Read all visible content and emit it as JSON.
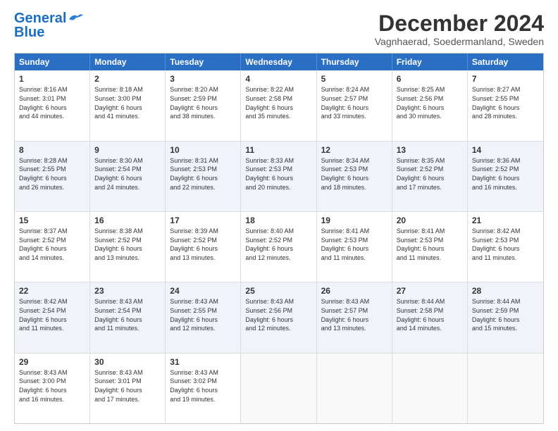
{
  "header": {
    "logo_line1": "General",
    "logo_line2": "Blue",
    "month_title": "December 2024",
    "subtitle": "Vagnhaerad, Soedermanland, Sweden"
  },
  "weekdays": [
    "Sunday",
    "Monday",
    "Tuesday",
    "Wednesday",
    "Thursday",
    "Friday",
    "Saturday"
  ],
  "rows": [
    [
      {
        "day": "1",
        "lines": [
          "Sunrise: 8:16 AM",
          "Sunset: 3:01 PM",
          "Daylight: 6 hours",
          "and 44 minutes."
        ]
      },
      {
        "day": "2",
        "lines": [
          "Sunrise: 8:18 AM",
          "Sunset: 3:00 PM",
          "Daylight: 6 hours",
          "and 41 minutes."
        ]
      },
      {
        "day": "3",
        "lines": [
          "Sunrise: 8:20 AM",
          "Sunset: 2:59 PM",
          "Daylight: 6 hours",
          "and 38 minutes."
        ]
      },
      {
        "day": "4",
        "lines": [
          "Sunrise: 8:22 AM",
          "Sunset: 2:58 PM",
          "Daylight: 6 hours",
          "and 35 minutes."
        ]
      },
      {
        "day": "5",
        "lines": [
          "Sunrise: 8:24 AM",
          "Sunset: 2:57 PM",
          "Daylight: 6 hours",
          "and 33 minutes."
        ]
      },
      {
        "day": "6",
        "lines": [
          "Sunrise: 8:25 AM",
          "Sunset: 2:56 PM",
          "Daylight: 6 hours",
          "and 30 minutes."
        ]
      },
      {
        "day": "7",
        "lines": [
          "Sunrise: 8:27 AM",
          "Sunset: 2:55 PM",
          "Daylight: 6 hours",
          "and 28 minutes."
        ]
      }
    ],
    [
      {
        "day": "8",
        "lines": [
          "Sunrise: 8:28 AM",
          "Sunset: 2:55 PM",
          "Daylight: 6 hours",
          "and 26 minutes."
        ]
      },
      {
        "day": "9",
        "lines": [
          "Sunrise: 8:30 AM",
          "Sunset: 2:54 PM",
          "Daylight: 6 hours",
          "and 24 minutes."
        ]
      },
      {
        "day": "10",
        "lines": [
          "Sunrise: 8:31 AM",
          "Sunset: 2:53 PM",
          "Daylight: 6 hours",
          "and 22 minutes."
        ]
      },
      {
        "day": "11",
        "lines": [
          "Sunrise: 8:33 AM",
          "Sunset: 2:53 PM",
          "Daylight: 6 hours",
          "and 20 minutes."
        ]
      },
      {
        "day": "12",
        "lines": [
          "Sunrise: 8:34 AM",
          "Sunset: 2:53 PM",
          "Daylight: 6 hours",
          "and 18 minutes."
        ]
      },
      {
        "day": "13",
        "lines": [
          "Sunrise: 8:35 AM",
          "Sunset: 2:52 PM",
          "Daylight: 6 hours",
          "and 17 minutes."
        ]
      },
      {
        "day": "14",
        "lines": [
          "Sunrise: 8:36 AM",
          "Sunset: 2:52 PM",
          "Daylight: 6 hours",
          "and 16 minutes."
        ]
      }
    ],
    [
      {
        "day": "15",
        "lines": [
          "Sunrise: 8:37 AM",
          "Sunset: 2:52 PM",
          "Daylight: 6 hours",
          "and 14 minutes."
        ]
      },
      {
        "day": "16",
        "lines": [
          "Sunrise: 8:38 AM",
          "Sunset: 2:52 PM",
          "Daylight: 6 hours",
          "and 13 minutes."
        ]
      },
      {
        "day": "17",
        "lines": [
          "Sunrise: 8:39 AM",
          "Sunset: 2:52 PM",
          "Daylight: 6 hours",
          "and 13 minutes."
        ]
      },
      {
        "day": "18",
        "lines": [
          "Sunrise: 8:40 AM",
          "Sunset: 2:52 PM",
          "Daylight: 6 hours",
          "and 12 minutes."
        ]
      },
      {
        "day": "19",
        "lines": [
          "Sunrise: 8:41 AM",
          "Sunset: 2:53 PM",
          "Daylight: 6 hours",
          "and 11 minutes."
        ]
      },
      {
        "day": "20",
        "lines": [
          "Sunrise: 8:41 AM",
          "Sunset: 2:53 PM",
          "Daylight: 6 hours",
          "and 11 minutes."
        ]
      },
      {
        "day": "21",
        "lines": [
          "Sunrise: 8:42 AM",
          "Sunset: 2:53 PM",
          "Daylight: 6 hours",
          "and 11 minutes."
        ]
      }
    ],
    [
      {
        "day": "22",
        "lines": [
          "Sunrise: 8:42 AM",
          "Sunset: 2:54 PM",
          "Daylight: 6 hours",
          "and 11 minutes."
        ]
      },
      {
        "day": "23",
        "lines": [
          "Sunrise: 8:43 AM",
          "Sunset: 2:54 PM",
          "Daylight: 6 hours",
          "and 11 minutes."
        ]
      },
      {
        "day": "24",
        "lines": [
          "Sunrise: 8:43 AM",
          "Sunset: 2:55 PM",
          "Daylight: 6 hours",
          "and 12 minutes."
        ]
      },
      {
        "day": "25",
        "lines": [
          "Sunrise: 8:43 AM",
          "Sunset: 2:56 PM",
          "Daylight: 6 hours",
          "and 12 minutes."
        ]
      },
      {
        "day": "26",
        "lines": [
          "Sunrise: 8:43 AM",
          "Sunset: 2:57 PM",
          "Daylight: 6 hours",
          "and 13 minutes."
        ]
      },
      {
        "day": "27",
        "lines": [
          "Sunrise: 8:44 AM",
          "Sunset: 2:58 PM",
          "Daylight: 6 hours",
          "and 14 minutes."
        ]
      },
      {
        "day": "28",
        "lines": [
          "Sunrise: 8:44 AM",
          "Sunset: 2:59 PM",
          "Daylight: 6 hours",
          "and 15 minutes."
        ]
      }
    ],
    [
      {
        "day": "29",
        "lines": [
          "Sunrise: 8:43 AM",
          "Sunset: 3:00 PM",
          "Daylight: 6 hours",
          "and 16 minutes."
        ]
      },
      {
        "day": "30",
        "lines": [
          "Sunrise: 8:43 AM",
          "Sunset: 3:01 PM",
          "Daylight: 6 hours",
          "and 17 minutes."
        ]
      },
      {
        "day": "31",
        "lines": [
          "Sunrise: 8:43 AM",
          "Sunset: 3:02 PM",
          "Daylight: 6 hours",
          "and 19 minutes."
        ]
      },
      {
        "day": "",
        "lines": []
      },
      {
        "day": "",
        "lines": []
      },
      {
        "day": "",
        "lines": []
      },
      {
        "day": "",
        "lines": []
      }
    ]
  ]
}
